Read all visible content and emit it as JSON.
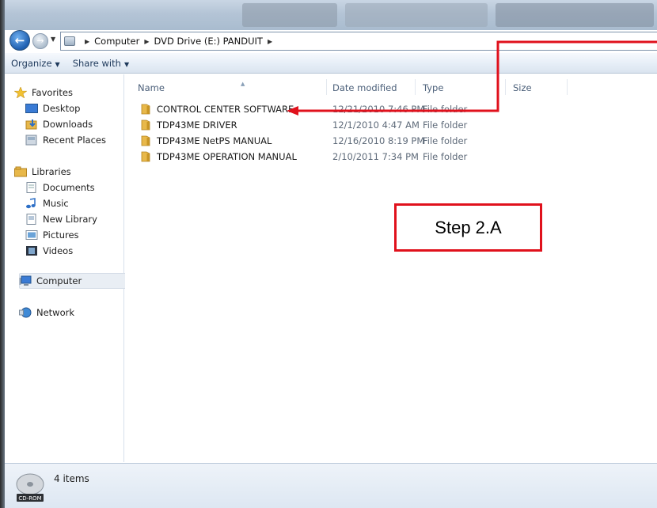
{
  "address": {
    "crumbs": [
      "Computer",
      "DVD Drive (E:) PANDUIT"
    ]
  },
  "toolbar": {
    "organize_label": "Organize",
    "share_label": "Share with"
  },
  "nav": {
    "favorites": "Favorites",
    "desktop": "Desktop",
    "downloads": "Downloads",
    "recent_places": "Recent Places",
    "libraries": "Libraries",
    "documents": "Documents",
    "music": "Music",
    "new_library": "New Library",
    "pictures": "Pictures",
    "videos": "Videos",
    "computer": "Computer",
    "network": "Network"
  },
  "columns": {
    "name": "Name",
    "date_modified": "Date modified",
    "type": "Type",
    "size": "Size"
  },
  "files": [
    {
      "name": "CONTROL CENTER SOFTWARE",
      "date": "12/21/2010 7:46 PM",
      "type": "File folder"
    },
    {
      "name": "TDP43ME DRIVER",
      "date": "12/1/2010 4:47 AM",
      "type": "File folder"
    },
    {
      "name": "TDP43ME NetPS MANUAL",
      "date": "12/16/2010 8:19 PM",
      "type": "File folder"
    },
    {
      "name": "TDP43ME OPERATION MANUAL",
      "date": "2/10/2011 7:34 PM",
      "type": "File folder"
    }
  ],
  "status": {
    "item_count": "4 items",
    "drive_label": "CD-ROM"
  },
  "annotation": {
    "step_label": "Step 2.A"
  },
  "colors": {
    "annotation_red": "#e0111c",
    "folder_yellow": "#e8b84a"
  }
}
